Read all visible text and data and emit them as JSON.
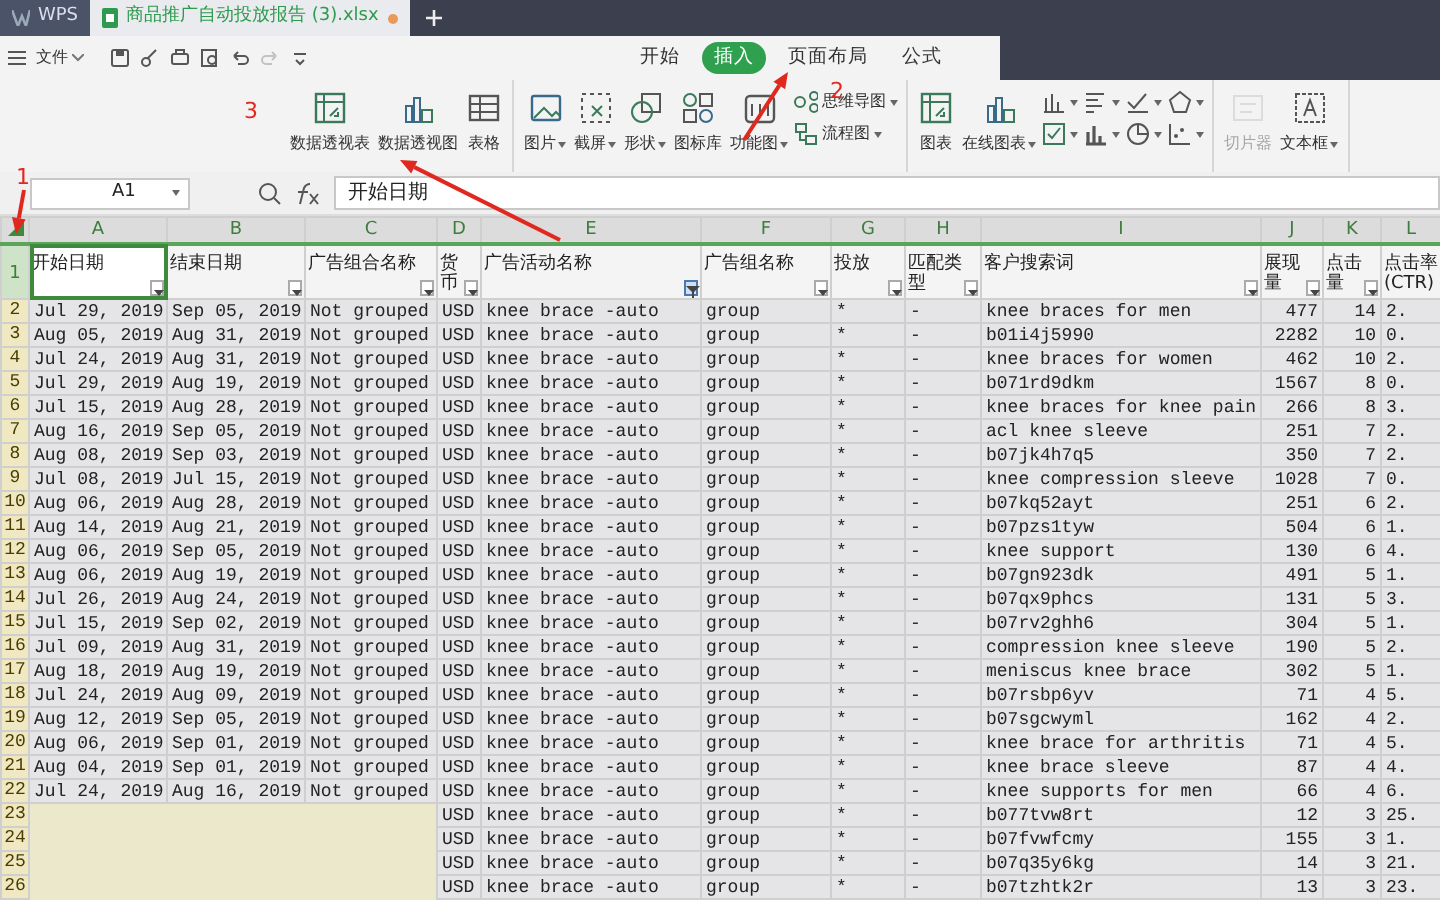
{
  "tabs": [
    {
      "label": "WPS",
      "kind": "app",
      "selected": false
    },
    {
      "label": "商品推广自动投放报告 (3).xlsx",
      "kind": "file",
      "selected": true,
      "modified": true
    }
  ],
  "menu": {
    "file_label": "文件",
    "quick_access": [
      {
        "disabled": false
      },
      {
        "disabled": false
      },
      {
        "disabled": false
      },
      {
        "disabled": false
      },
      {
        "disabled": false
      },
      {
        "disabled": true
      },
      {
        "disabled": false
      }
    ],
    "ribbon_tabs": [
      {
        "label": "开始",
        "selected": false
      },
      {
        "label": "插入",
        "selected": true
      },
      {
        "label": "页面布局",
        "selected": false
      },
      {
        "label": "公式",
        "selected": false
      }
    ]
  },
  "ribbon": {
    "groups": [
      {
        "items": [
          {
            "kind": "large",
            "label": "数据透视表",
            "dropdown": false,
            "disabled": false
          },
          {
            "kind": "large",
            "label": "数据透视图",
            "dropdown": false,
            "disabled": false
          },
          {
            "kind": "large",
            "label": "表格",
            "dropdown": false,
            "disabled": false
          }
        ]
      },
      {
        "items": [
          {
            "kind": "large",
            "label": "图片",
            "dropdown": true,
            "disabled": false
          },
          {
            "kind": "large",
            "label": "截屏",
            "dropdown": true,
            "disabled": false
          },
          {
            "kind": "large",
            "label": "形状",
            "dropdown": true,
            "disabled": false
          },
          {
            "kind": "large",
            "label": "图标库",
            "dropdown": false,
            "disabled": false
          },
          {
            "kind": "large",
            "label": "功能图",
            "dropdown": true,
            "disabled": false
          },
          {
            "kind": "small",
            "label": "思维导图",
            "dropdown": true,
            "disabled": false
          },
          {
            "kind": "small",
            "label": "流程图",
            "dropdown": true,
            "disabled": false
          }
        ]
      },
      {
        "items": [
          {
            "kind": "large",
            "label": "图表",
            "dropdown": false,
            "disabled": false
          },
          {
            "kind": "large",
            "label": "在线图表",
            "dropdown": true,
            "disabled": false
          },
          {
            "kind": "icon",
            "dropdown": true,
            "disabled": false
          },
          {
            "kind": "icon",
            "dropdown": true,
            "disabled": false
          },
          {
            "kind": "icon",
            "dropdown": true,
            "disabled": false
          },
          {
            "kind": "icon",
            "dropdown": true,
            "disabled": false
          },
          {
            "kind": "icon",
            "dropdown": true,
            "disabled": false
          },
          {
            "kind": "icon",
            "dropdown": true,
            "disabled": false
          },
          {
            "kind": "icon",
            "dropdown": true,
            "disabled": false
          },
          {
            "kind": "icon",
            "dropdown": true,
            "disabled": false
          }
        ]
      },
      {
        "items": [
          {
            "kind": "large",
            "label": "切片器",
            "dropdown": false,
            "disabled": true
          },
          {
            "kind": "large",
            "label": "文本框",
            "dropdown": true,
            "disabled": false
          }
        ]
      }
    ]
  },
  "formula_bar": {
    "cell": "A1",
    "value": "开始日期"
  },
  "columns": [
    "A",
    "B",
    "C",
    "D",
    "E",
    "F",
    "G",
    "H",
    "I",
    "J",
    "K",
    "L"
  ],
  "header_row": {
    "num": "1",
    "cells": [
      {
        "label": "开始日期",
        "filter": true,
        "filtered": false
      },
      {
        "label": "结束日期",
        "filter": true,
        "filtered": false
      },
      {
        "label": "广告组合名称",
        "filter": true,
        "filtered": false
      },
      {
        "label": "货币",
        "filter": true,
        "filtered": false
      },
      {
        "label": "广告活动名称",
        "filter": true,
        "filtered": true
      },
      {
        "label": "广告组名称",
        "filter": true,
        "filtered": false
      },
      {
        "label": "投放",
        "filter": true,
        "filtered": false
      },
      {
        "label": "匹配类型",
        "filter": true,
        "filtered": false
      },
      {
        "label": "客户搜索词",
        "filter": true,
        "filtered": false
      },
      {
        "label": "展现量",
        "filter": true,
        "filtered": false
      },
      {
        "label": "点击量",
        "filter": true,
        "filtered": false
      },
      {
        "label": "点击率(CTR)",
        "filter": false
      }
    ]
  },
  "rows": [
    {
      "num": "2",
      "obscured": false,
      "cells": [
        "Jul 29, 2019",
        "Sep 05, 2019",
        "Not grouped",
        "USD",
        "knee brace -auto",
        "group",
        "*",
        "-",
        "knee braces for men",
        "477",
        "14",
        "2."
      ]
    },
    {
      "num": "3",
      "obscured": false,
      "cells": [
        "Aug 05, 2019",
        "Aug 31, 2019",
        "Not grouped",
        "USD",
        "knee brace -auto",
        "group",
        "*",
        "-",
        "b01i4j5990",
        "2282",
        "10",
        "0."
      ]
    },
    {
      "num": "4",
      "obscured": false,
      "cells": [
        "Jul 24, 2019",
        "Aug 31, 2019",
        "Not grouped",
        "USD",
        "knee brace -auto",
        "group",
        "*",
        "-",
        "knee braces for women",
        "462",
        "10",
        "2."
      ]
    },
    {
      "num": "5",
      "obscured": false,
      "cells": [
        "Jul 29, 2019",
        "Aug 19, 2019",
        "Not grouped",
        "USD",
        "knee brace -auto",
        "group",
        "*",
        "-",
        "b071rd9dkm",
        "1567",
        "8",
        "0."
      ]
    },
    {
      "num": "6",
      "obscured": false,
      "cells": [
        "Jul 15, 2019",
        "Aug 28, 2019",
        "Not grouped",
        "USD",
        "knee brace -auto",
        "group",
        "*",
        "-",
        "knee braces for knee pain",
        "266",
        "8",
        "3."
      ]
    },
    {
      "num": "7",
      "obscured": false,
      "cells": [
        "Aug 16, 2019",
        "Sep 05, 2019",
        "Not grouped",
        "USD",
        "knee brace -auto",
        "group",
        "*",
        "-",
        "acl knee sleeve",
        "251",
        "7",
        "2."
      ]
    },
    {
      "num": "8",
      "obscured": false,
      "cells": [
        "Aug 08, 2019",
        "Sep 03, 2019",
        "Not grouped",
        "USD",
        "knee brace -auto",
        "group",
        "*",
        "-",
        "b07jk4h7q5",
        "350",
        "7",
        "2."
      ]
    },
    {
      "num": "9",
      "obscured": false,
      "cells": [
        "Jul 08, 2019",
        "Jul 15, 2019",
        "Not grouped",
        "USD",
        "knee brace -auto",
        "group",
        "*",
        "-",
        "knee compression sleeve",
        "1028",
        "7",
        "0."
      ]
    },
    {
      "num": "10",
      "obscured": false,
      "cells": [
        "Aug 06, 2019",
        "Aug 28, 2019",
        "Not grouped",
        "USD",
        "knee brace -auto",
        "group",
        "*",
        "-",
        "b07kq52ayt",
        "251",
        "6",
        "2."
      ]
    },
    {
      "num": "11",
      "obscured": false,
      "cells": [
        "Aug 14, 2019",
        "Aug 21, 2019",
        "Not grouped",
        "USD",
        "knee brace -auto",
        "group",
        "*",
        "-",
        "b07pzs1tyw",
        "504",
        "6",
        "1."
      ]
    },
    {
      "num": "12",
      "obscured": false,
      "cells": [
        "Aug 06, 2019",
        "Sep 05, 2019",
        "Not grouped",
        "USD",
        "knee brace -auto",
        "group",
        "*",
        "-",
        "knee support",
        "130",
        "6",
        "4."
      ]
    },
    {
      "num": "13",
      "obscured": false,
      "cells": [
        "Aug 06, 2019",
        "Aug 19, 2019",
        "Not grouped",
        "USD",
        "knee brace -auto",
        "group",
        "*",
        "-",
        "b07gn923dk",
        "491",
        "5",
        "1."
      ]
    },
    {
      "num": "14",
      "obscured": false,
      "cells": [
        "Jul 26, 2019",
        "Aug 24, 2019",
        "Not grouped",
        "USD",
        "knee brace -auto",
        "group",
        "*",
        "-",
        "b07qx9phcs",
        "131",
        "5",
        "3."
      ]
    },
    {
      "num": "15",
      "obscured": false,
      "cells": [
        "Jul 15, 2019",
        "Sep 02, 2019",
        "Not grouped",
        "USD",
        "knee brace -auto",
        "group",
        "*",
        "-",
        "b07rv2ghh6",
        "304",
        "5",
        "1."
      ]
    },
    {
      "num": "16",
      "obscured": false,
      "cells": [
        "Jul 09, 2019",
        "Aug 31, 2019",
        "Not grouped",
        "USD",
        "knee brace -auto",
        "group",
        "*",
        "-",
        "compression knee sleeve",
        "190",
        "5",
        "2."
      ]
    },
    {
      "num": "17",
      "obscured": false,
      "cells": [
        "Aug 18, 2019",
        "Aug 19, 2019",
        "Not grouped",
        "USD",
        "knee brace -auto",
        "group",
        "*",
        "-",
        "meniscus knee brace",
        "302",
        "5",
        "1."
      ]
    },
    {
      "num": "18",
      "obscured": false,
      "cells": [
        "Jul 24, 2019",
        "Aug 09, 2019",
        "Not grouped",
        "USD",
        "knee brace -auto",
        "group",
        "*",
        "-",
        "b07rsbp6yv",
        "71",
        "4",
        "5."
      ]
    },
    {
      "num": "19",
      "obscured": false,
      "cells": [
        "Aug 12, 2019",
        "Sep 05, 2019",
        "Not grouped",
        "USD",
        "knee brace -auto",
        "group",
        "*",
        "-",
        "b07sgcwyml",
        "162",
        "4",
        "2."
      ]
    },
    {
      "num": "20",
      "obscured": false,
      "cells": [
        "Aug 06, 2019",
        "Sep 01, 2019",
        "Not grouped",
        "USD",
        "knee brace -auto",
        "group",
        "*",
        "-",
        "knee brace for arthritis",
        "71",
        "4",
        "5."
      ]
    },
    {
      "num": "21",
      "obscured": false,
      "cells": [
        "Aug 04, 2019",
        "Sep 01, 2019",
        "Not grouped",
        "USD",
        "knee brace -auto",
        "group",
        "*",
        "-",
        "knee brace sleeve",
        "87",
        "4",
        "4."
      ]
    },
    {
      "num": "22",
      "obscured": false,
      "cells": [
        "Jul 24, 2019",
        "Aug 16, 2019",
        "Not grouped",
        "USD",
        "knee brace -auto",
        "group",
        "*",
        "-",
        "knee supports for men",
        "66",
        "4",
        "6."
      ]
    },
    {
      "num": "23",
      "obscured": true,
      "cells": [
        "USD",
        "knee brace -auto",
        "group",
        "*",
        "-",
        "b077tvw8rt",
        "12",
        "3",
        "25."
      ]
    },
    {
      "num": "24",
      "obscured": true,
      "cells": [
        "USD",
        "knee brace -auto",
        "group",
        "*",
        "-",
        "b07fvwfcmy",
        "155",
        "3",
        "1."
      ]
    },
    {
      "num": "25",
      "obscured": true,
      "cells": [
        "USD",
        "knee brace -auto",
        "group",
        "*",
        "-",
        "b07q35y6kg",
        "14",
        "3",
        "21."
      ]
    },
    {
      "num": "26",
      "obscured": true,
      "cells": [
        "USD",
        "knee brace -auto",
        "group",
        "*",
        "-",
        "b07tzhtk2r",
        "13",
        "3",
        "23."
      ]
    }
  ],
  "annotations": [
    {
      "label": "1"
    },
    {
      "label": "2"
    },
    {
      "label": "3"
    }
  ]
}
